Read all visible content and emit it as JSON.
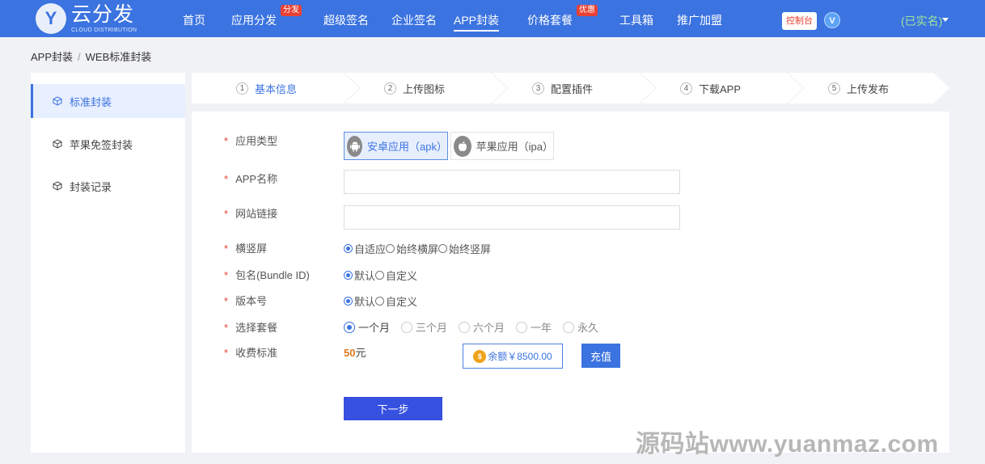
{
  "logo": {
    "letter": "Y",
    "name": "云分发",
    "sub": "CLOUD DISTRIBUTION"
  },
  "nav": {
    "items": [
      {
        "label": "首页"
      },
      {
        "label": "应用分发",
        "badge": "分发"
      },
      {
        "label": "超级签名"
      },
      {
        "label": "企业签名"
      },
      {
        "label": "APP封装"
      },
      {
        "label": "价格套餐",
        "badge": "优惠"
      },
      {
        "label": "工具箱"
      },
      {
        "label": "推广加盟"
      }
    ],
    "console": "控制台",
    "vip": "V",
    "user": "(已实名)"
  },
  "breadcrumb": {
    "root": "APP封装",
    "sep": "/",
    "current": "WEB标准封装"
  },
  "sidebar": {
    "items": [
      {
        "label": "标准封装"
      },
      {
        "label": "苹果免签封装"
      },
      {
        "label": "封装记录"
      }
    ]
  },
  "steps": [
    {
      "num": "1",
      "label": "基本信息"
    },
    {
      "num": "2",
      "label": "上传图标"
    },
    {
      "num": "3",
      "label": "配置插件"
    },
    {
      "num": "4",
      "label": "下载APP"
    },
    {
      "num": "5",
      "label": "上传发布"
    }
  ],
  "form": {
    "app_type": {
      "label": "应用类型",
      "apk": "安卓应用（apk）",
      "ipa": "苹果应用（ipa）"
    },
    "app_name": {
      "label": "APP名称",
      "value": "",
      "placeholder": ""
    },
    "site_url": {
      "label": "网站链接",
      "value": "",
      "placeholder": ""
    },
    "orientation": {
      "label": "横竖屏",
      "options": [
        "自适应",
        "始终横屏",
        "始终竖屏"
      ]
    },
    "bundle": {
      "label": "包名(Bundle ID)",
      "options": [
        "默认",
        "自定义"
      ]
    },
    "version": {
      "label": "版本号",
      "options": [
        "默认",
        "自定义"
      ]
    },
    "package": {
      "label": "选择套餐",
      "options": [
        "一个月",
        "三个月",
        "六个月",
        "一年",
        "永久"
      ]
    },
    "fee": {
      "label": "收费标准",
      "amount": "50",
      "unit": "元"
    },
    "balance": "余额￥8500.00",
    "coin": "$",
    "recharge": "充值",
    "next": "下一步"
  },
  "watermark": "源码站www.yuanmaz.com",
  "colors": {
    "primary": "#3b73e0",
    "badge": "#e84133",
    "verified": "#9fe59a",
    "fee": "#e07a1f"
  }
}
